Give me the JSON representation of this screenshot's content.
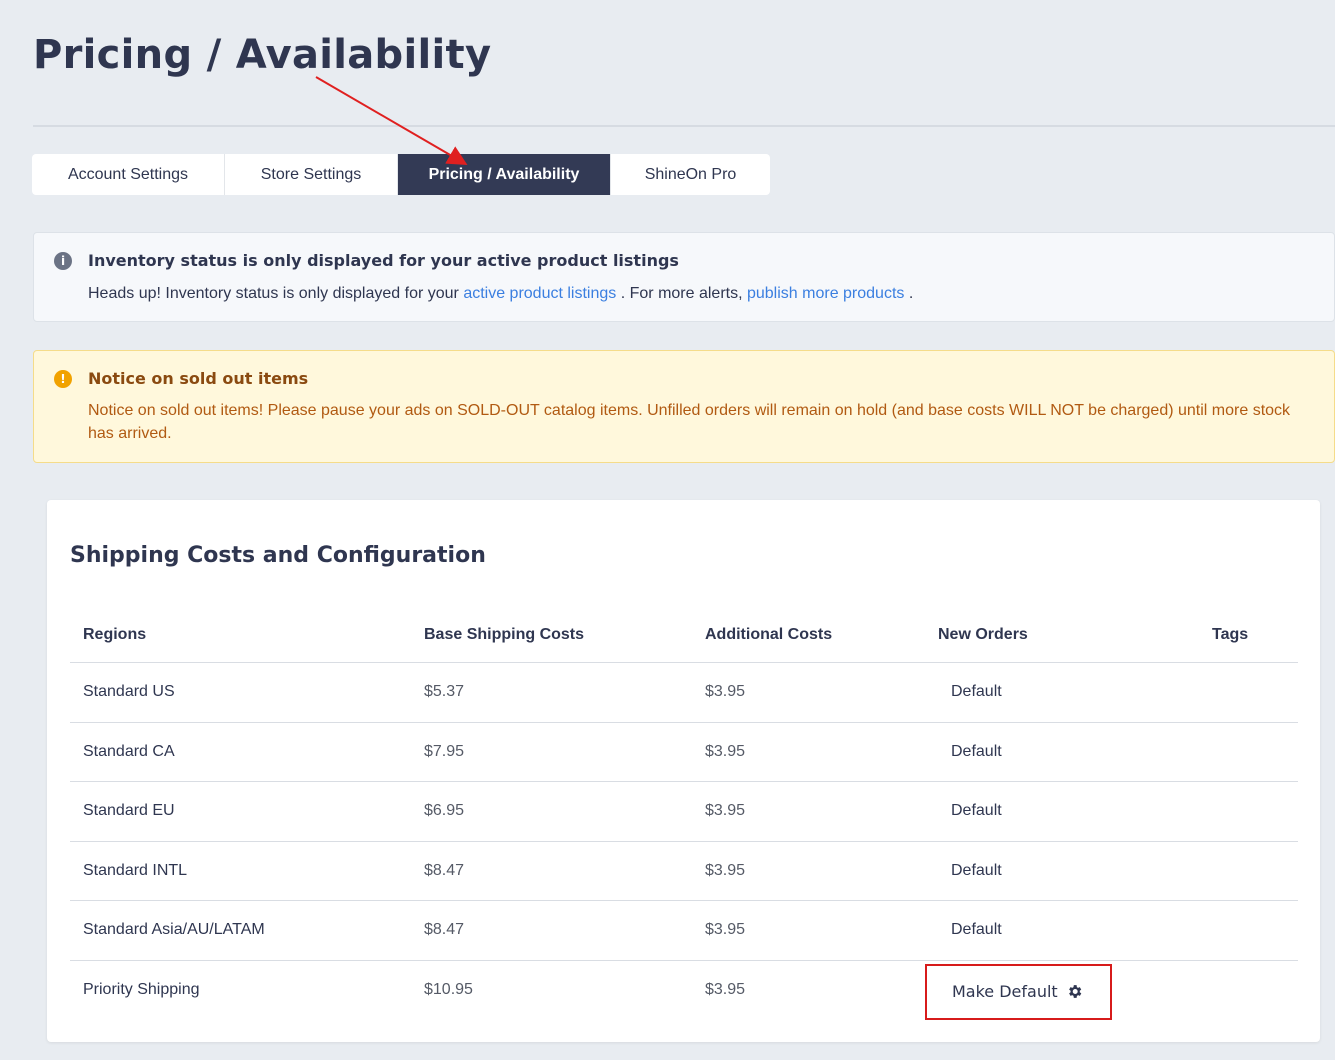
{
  "page": {
    "title": "Pricing / Availability"
  },
  "tabs": [
    {
      "label": "Account Settings",
      "active": false
    },
    {
      "label": "Store Settings",
      "active": false
    },
    {
      "label": "Pricing / Availability",
      "active": true
    },
    {
      "label": "ShineOn Pro",
      "active": false
    }
  ],
  "info_alert": {
    "icon": "info-icon",
    "title": "Inventory status is only displayed for your active product listings",
    "body_prefix": "Heads up! Inventory status is only displayed for your ",
    "link1": "active product listings",
    "body_middle": " . For more alerts, ",
    "link2": "publish more products",
    "body_suffix": " ."
  },
  "warn_alert": {
    "icon": "exclamation-icon",
    "title": "Notice on sold out items",
    "body": "Notice on sold out items! Please pause your ads on SOLD-OUT catalog items. Unfilled orders will remain on hold (and base costs WILL NOT be charged) until more stock has arrived."
  },
  "shipping": {
    "title": "Shipping Costs and Configuration",
    "columns": [
      "Regions",
      "Base Shipping Costs",
      "Additional Costs",
      "New Orders",
      "Tags"
    ],
    "rows": [
      {
        "region": "Standard US",
        "base": "$5.37",
        "additional": "$3.95",
        "new_orders": "Default"
      },
      {
        "region": "Standard CA",
        "base": "$7.95",
        "additional": "$3.95",
        "new_orders": "Default"
      },
      {
        "region": "Standard EU",
        "base": "$6.95",
        "additional": "$3.95",
        "new_orders": "Default"
      },
      {
        "region": "Standard INTL",
        "base": "$8.47",
        "additional": "$3.95",
        "new_orders": "Default"
      },
      {
        "region": "Standard Asia/AU/LATAM",
        "base": "$8.47",
        "additional": "$3.95",
        "new_orders": "Default"
      },
      {
        "region": "Priority Shipping",
        "base": "$10.95",
        "additional": "$3.95",
        "new_orders": "Make Default",
        "action_icon": "gear-icon"
      }
    ]
  },
  "colors": {
    "background": "#e8ecf1",
    "active_tab": "#333a55",
    "link": "#3b7fe0",
    "warning_text": "#b15a12",
    "annotation_red": "#d71b1b"
  }
}
